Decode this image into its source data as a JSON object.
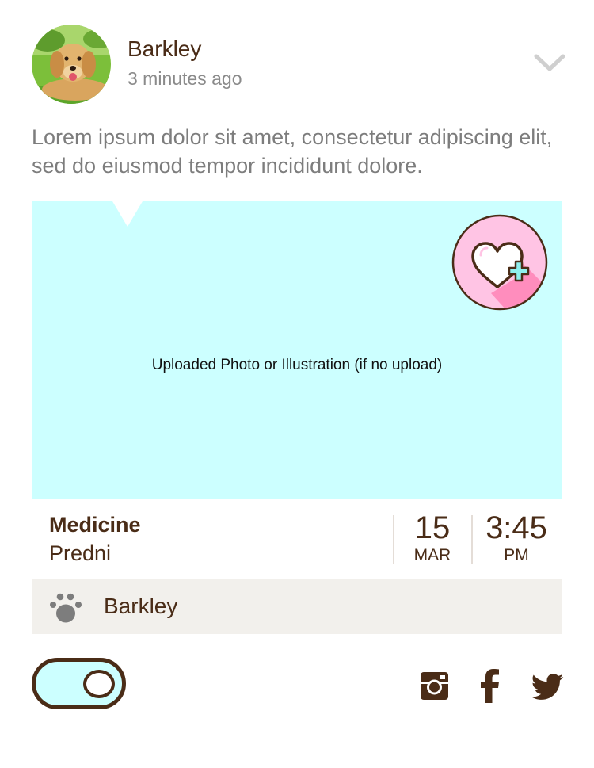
{
  "post": {
    "author": "Barkley",
    "timestamp": "3 minutes ago",
    "body": "Lorem ipsum dolor sit amet, consectetur adipiscing elit, sed do eiusmod tempor incididunt dolore."
  },
  "media": {
    "caption": "Uploaded Photo or Illustration (if no upload)",
    "background_color": "#ccffff",
    "favorite_icon": "heart-plus-icon"
  },
  "details": {
    "category": "Medicine",
    "subcategory": "Predni",
    "date_day": "15",
    "date_month": "MAR",
    "time": "3:45",
    "time_period": "PM"
  },
  "pet": {
    "name": "Barkley",
    "icon": "paw-icon"
  },
  "toggle": {
    "state": "on",
    "color": "#ccffff"
  },
  "social": [
    "instagram-icon",
    "facebook-icon",
    "twitter-icon"
  ],
  "colors": {
    "brand_brown": "#4a2c17",
    "accent_cyan": "#ccffff",
    "accent_pink": "#ffc4e4"
  }
}
